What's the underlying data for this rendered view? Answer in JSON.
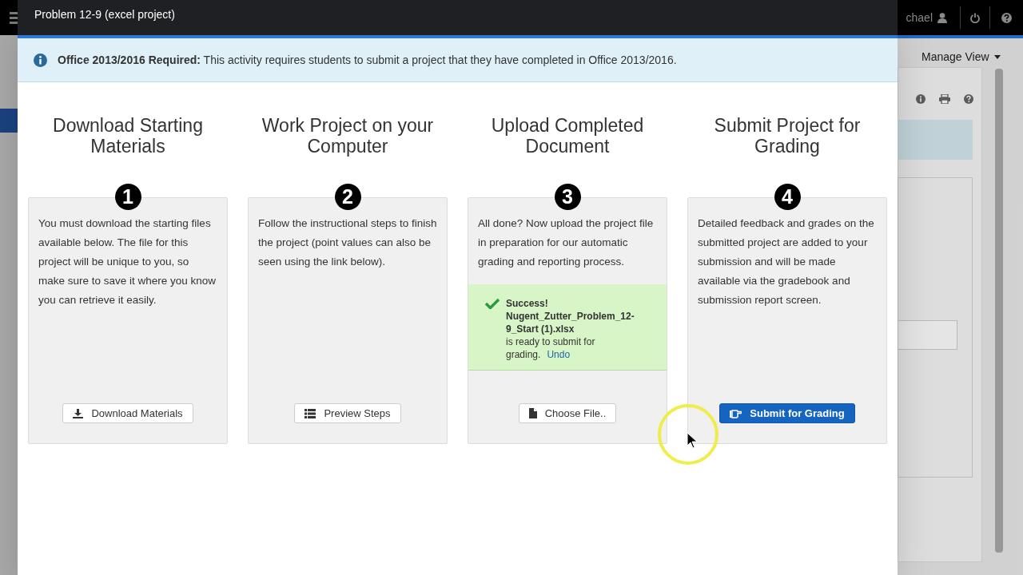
{
  "background": {
    "user_name": "chael",
    "manage_view": "Manage View"
  },
  "modal": {
    "title": "Problem 12-9 (excel project)",
    "alert": {
      "label": "Office 2013/2016 Required:",
      "text": "This activity requires students to submit a project that they have completed in Office 2013/2016."
    },
    "steps": [
      {
        "number": "1",
        "title": "Download Starting Materials",
        "description": "You must download the starting files available below. The file for this project will be unique to you, so make sure to save it where you know you can retrieve it easily.",
        "button": {
          "label": "Download Materials",
          "kind": "download",
          "primary": false
        }
      },
      {
        "number": "2",
        "title": "Work Project on your Computer",
        "description": "Follow the instructional steps to finish the project (point values can also be seen using the link below).",
        "button": {
          "label": "Preview Steps",
          "kind": "list",
          "primary": false
        }
      },
      {
        "number": "3",
        "title": "Upload Completed Document",
        "description": "All done? Now upload the project file in preparation for our automatic grading and reporting process.",
        "success": {
          "heading": "Success!",
          "file": "Nugent_Zutter_Problem_12-9_Start (1).xlsx",
          "text": "is ready to submit for grading.",
          "link": "Undo"
        },
        "button": {
          "label": "Choose File..",
          "kind": "file",
          "primary": false
        }
      },
      {
        "number": "4",
        "title": "Submit Project for Grading",
        "description": "Detailed feedback and grades on the submitted project are added to your submission and will be made available via the gradebook and submission report screen.",
        "button": {
          "label": "Submit for Grading",
          "kind": "hand",
          "primary": true
        }
      }
    ]
  }
}
